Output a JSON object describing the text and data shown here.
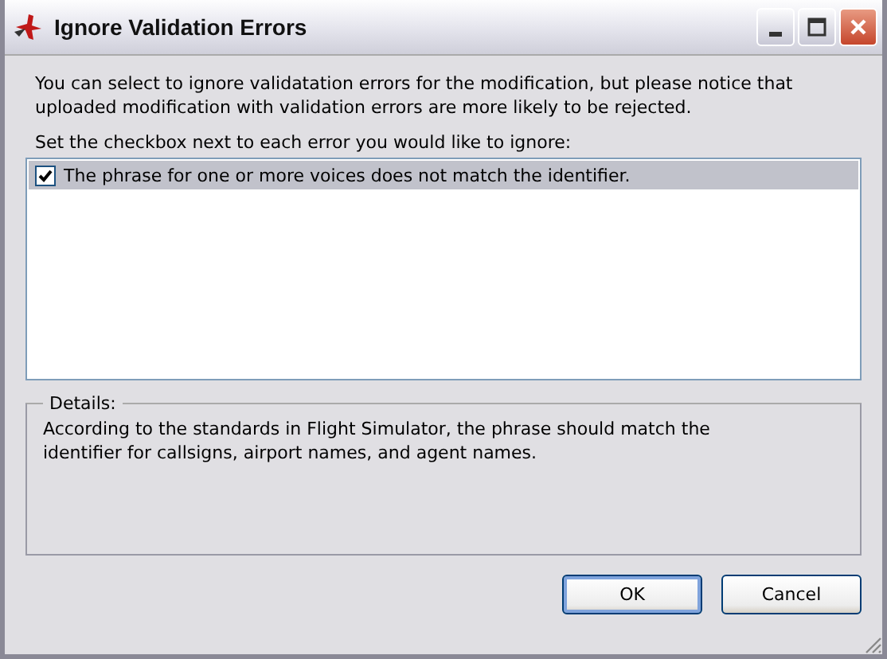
{
  "window": {
    "title": "Ignore Validation Errors"
  },
  "intro": "You can select to ignore validatation errors for the modification, but please notice that uploaded modification with validation errors are more likely to be rejected.",
  "list_label": "Set the checkbox next to each error you would like to ignore:",
  "errors": [
    {
      "text": "The phrase for one or more voices does not match the identifier.",
      "checked": true,
      "selected": true
    }
  ],
  "details": {
    "legend": "Details:",
    "text": "According to the standards in Flight Simulator, the phrase should match the identifier for callsigns, airport names, and agent names."
  },
  "buttons": [
    {
      "label": "OK",
      "default": true
    },
    {
      "label": "Cancel",
      "default": false
    }
  ]
}
